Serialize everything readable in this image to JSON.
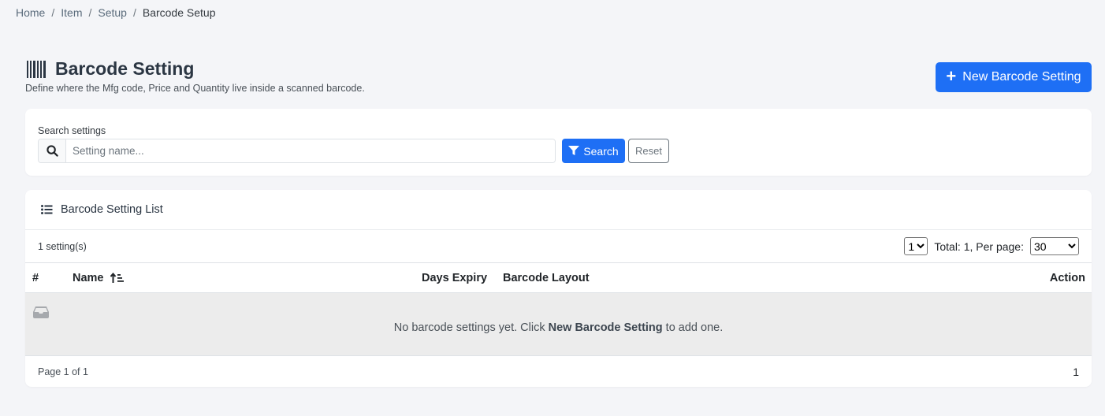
{
  "breadcrumb": {
    "items": [
      "Home",
      "Item",
      "Setup"
    ],
    "current": "Barcode Setup",
    "separator": "/"
  },
  "header": {
    "title": "Barcode Setting",
    "subtitle": "Define where the Mfg code, Price and Quantity live inside a scanned barcode.",
    "title_icon": "barcode-icon",
    "new_button_label": "New Barcode Setting"
  },
  "search": {
    "label": "Search settings",
    "placeholder": "Setting name...",
    "value": "",
    "search_button_label": "Search",
    "reset_button_label": "Reset"
  },
  "list": {
    "title": "Barcode Setting List",
    "count_text": "1 setting(s)",
    "page_selected": "1",
    "total_text": "Total: 1, Per page:",
    "per_page_selected": "30",
    "columns": {
      "num": "#",
      "name": "Name",
      "days_expiry": "Days Expiry",
      "barcode_layout": "Barcode Layout",
      "action": "Action"
    },
    "empty": {
      "prefix": "No barcode settings yet. Click ",
      "link": "New Barcode Setting",
      "suffix": " to add one."
    },
    "footer_page_text": "Page 1 of 1",
    "footer_page_number": "1"
  },
  "colors": {
    "primary": "#1e6ff5",
    "background": "#f4f5f8",
    "empty_row": "#ececec"
  }
}
